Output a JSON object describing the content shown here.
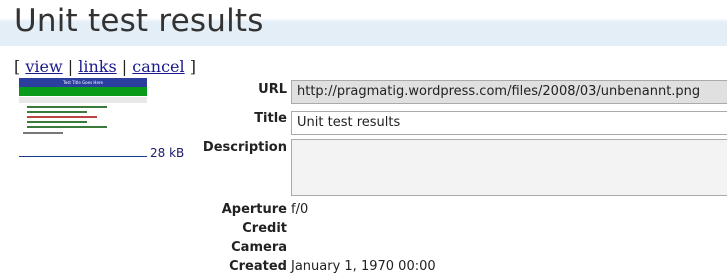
{
  "page": {
    "title": "Unit test results"
  },
  "actions": {
    "open_bracket": "[",
    "view": "view",
    "sep1": "|",
    "links": "links",
    "sep2": "|",
    "cancel": "cancel",
    "close_bracket": "]"
  },
  "file": {
    "size": "28 kB"
  },
  "fields": {
    "url_label": "URL",
    "url_value": "http://pragmatig.wordpress.com/files/2008/03/unbenannt.png",
    "title_label": "Title",
    "title_value": "Unit test results",
    "description_label": "Description",
    "description_value": "",
    "aperture_label": "Aperture",
    "aperture_value": "f/0",
    "credit_label": "Credit",
    "credit_value": "",
    "camera_label": "Camera",
    "camera_value": "",
    "created_label": "Created",
    "created_value": "January 1, 1970 00:00"
  },
  "thumbnail": {
    "header_text": "Test Title Goes Here"
  }
}
